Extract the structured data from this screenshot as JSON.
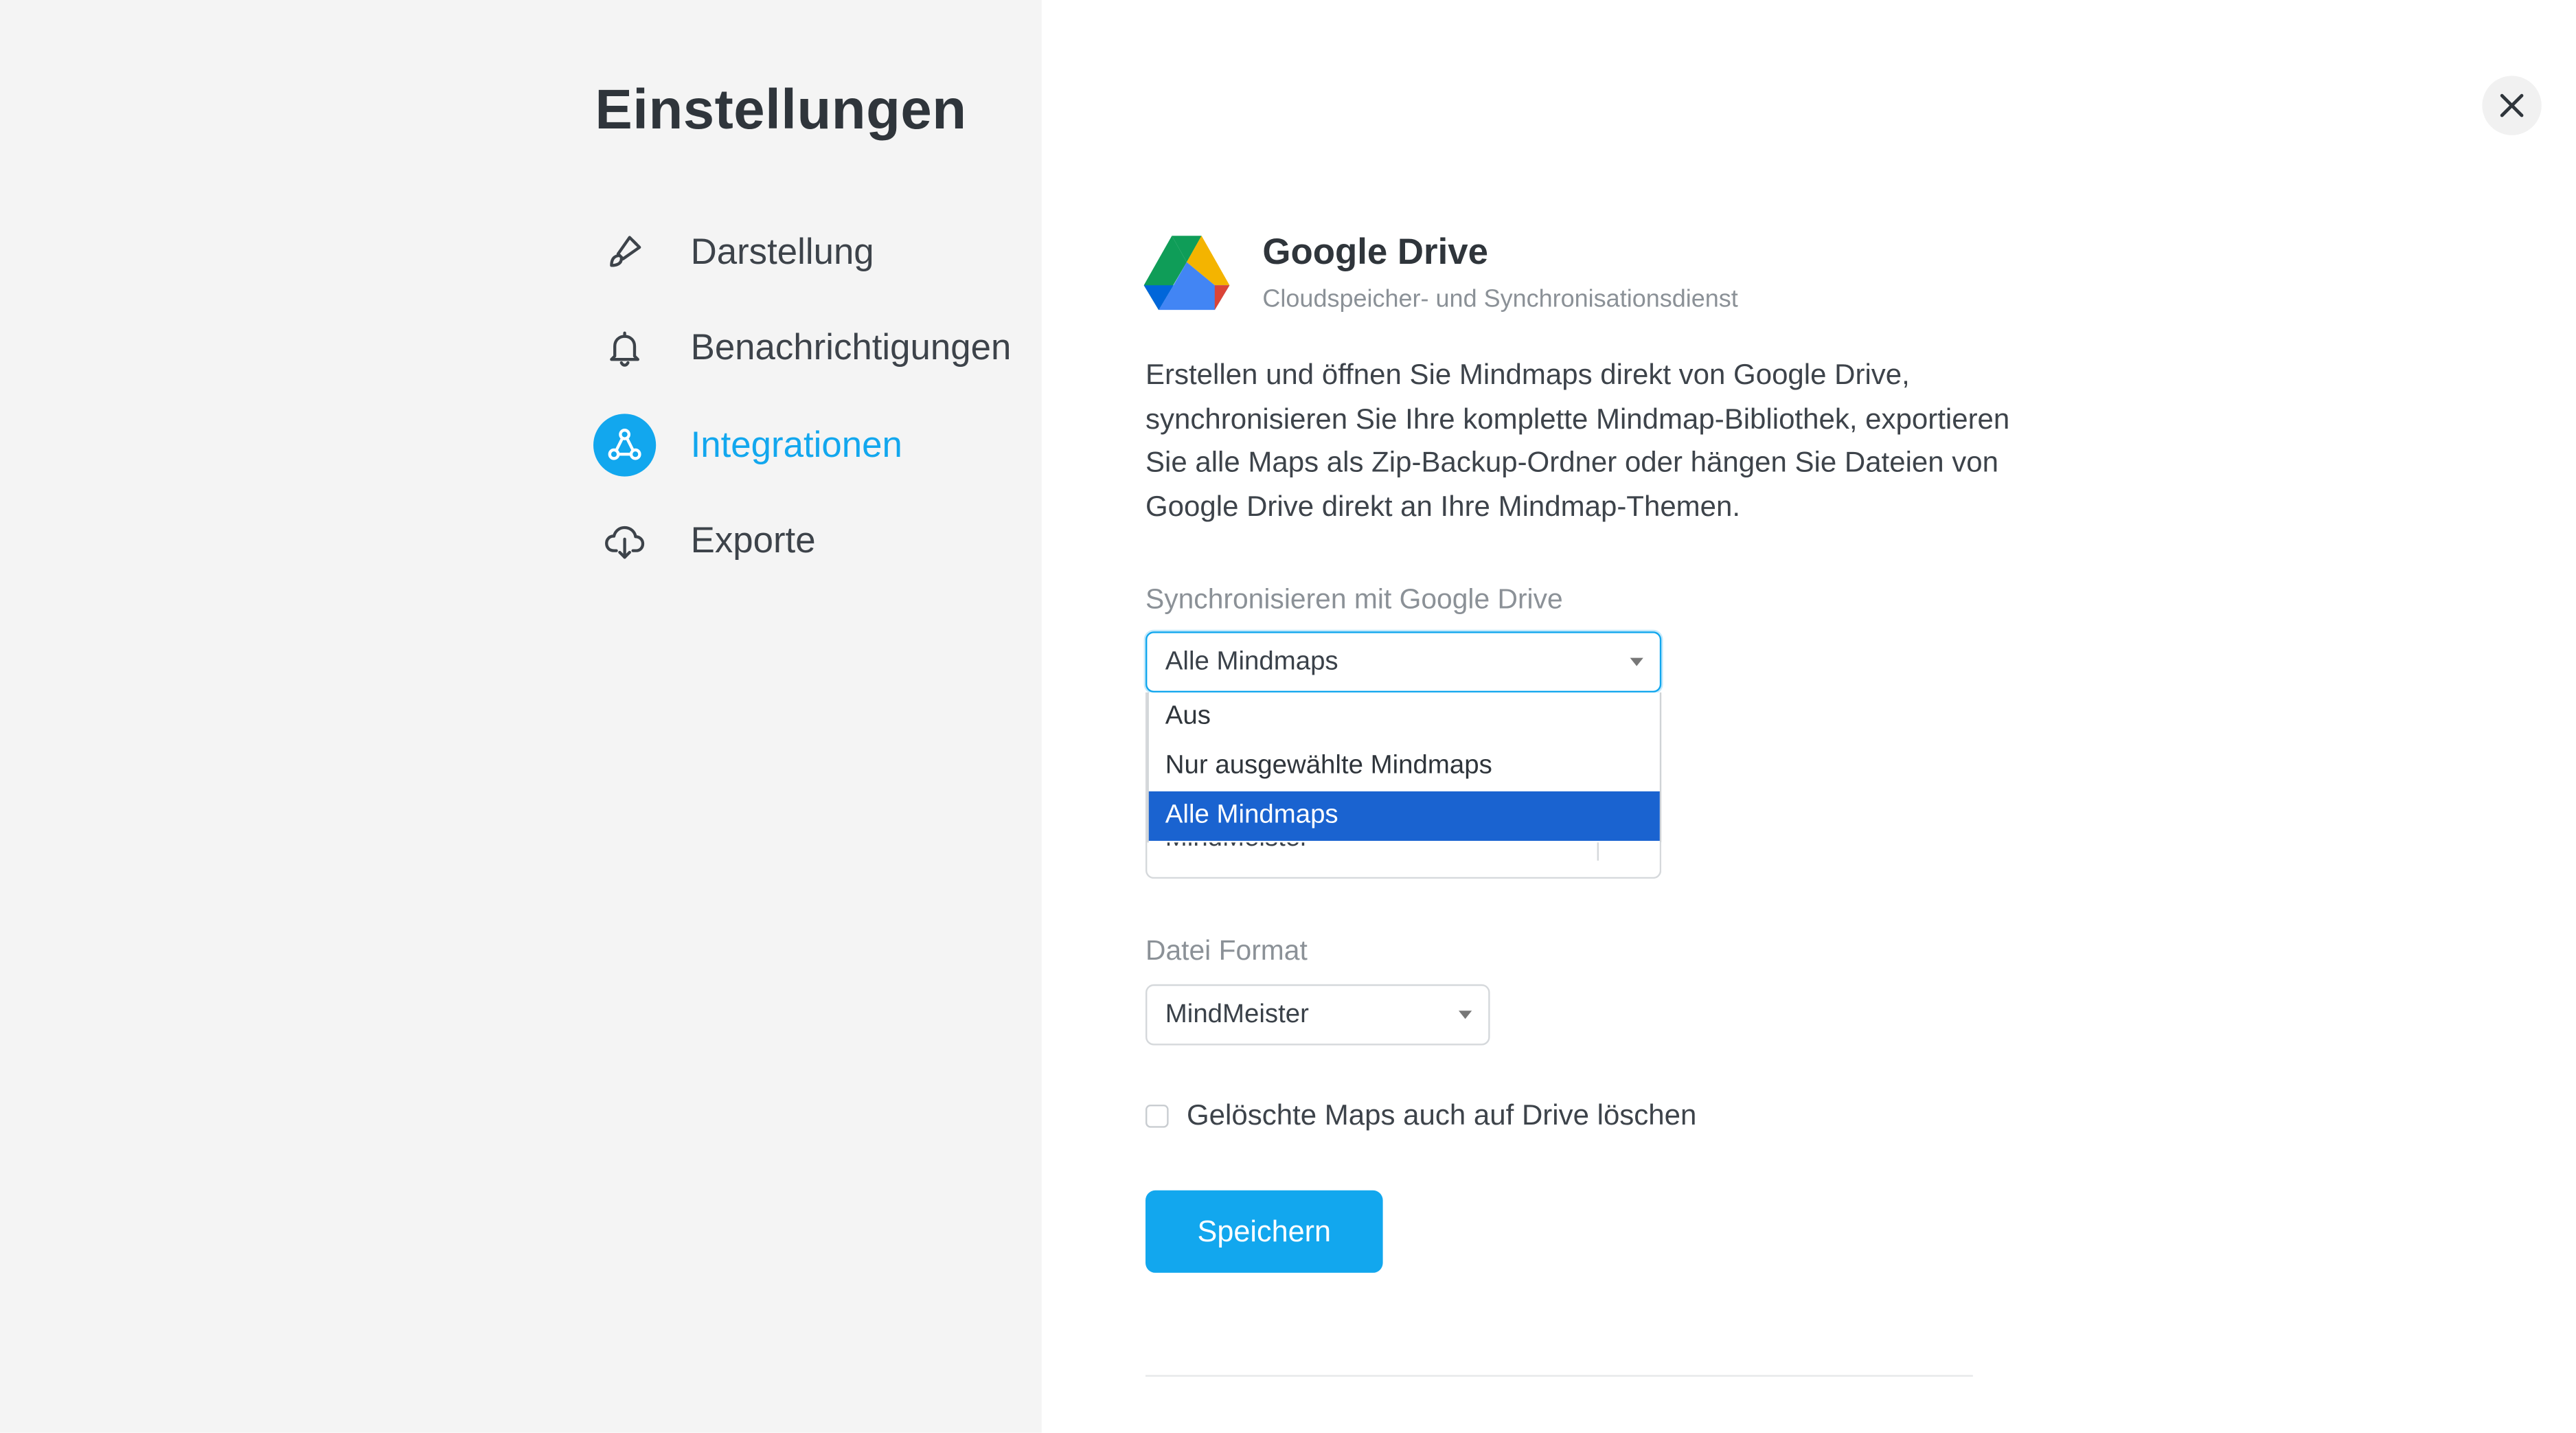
{
  "sidebar": {
    "title": "Einstellungen",
    "items": [
      {
        "label": "Darstellung",
        "icon": "paint-brush-icon",
        "active": false
      },
      {
        "label": "Benachrichtigungen",
        "icon": "bell-icon",
        "active": false
      },
      {
        "label": "Integrationen",
        "icon": "integrations-icon",
        "active": true
      },
      {
        "label": "Exporte",
        "icon": "cloud-download-icon",
        "active": false
      }
    ]
  },
  "integration": {
    "name": "Google Drive",
    "subtitle": "Cloudspeicher- und Synchronisationsdienst",
    "description": "Erstellen und öffnen Sie Mindmaps direkt von Google Drive, synchronisieren Sie Ihre komplette Mindmap-Bibliothek, exportieren Sie alle Maps als Zip-Backup-Ordner oder hängen Sie Dateien von Google Drive direkt an Ihre Mindmap-Themen."
  },
  "sync": {
    "label": "Synchronisieren mit Google Drive",
    "value": "Alle Mindmaps",
    "options": [
      "Aus",
      "Nur ausgewählte Mindmaps",
      "Alle Mindmaps"
    ],
    "selected_index": 2
  },
  "hidden_field": {
    "partial_text": "MindMeister"
  },
  "format": {
    "label": "Datei Format",
    "value": "MindMeister"
  },
  "delete_checkbox": {
    "label": "Gelöschte Maps auch auf Drive löschen",
    "checked": false
  },
  "save_label": "Speichern",
  "colors": {
    "accent": "#12a7ee",
    "selected_option": "#1a63d0",
    "sidebar_bg": "#f4f4f4"
  }
}
